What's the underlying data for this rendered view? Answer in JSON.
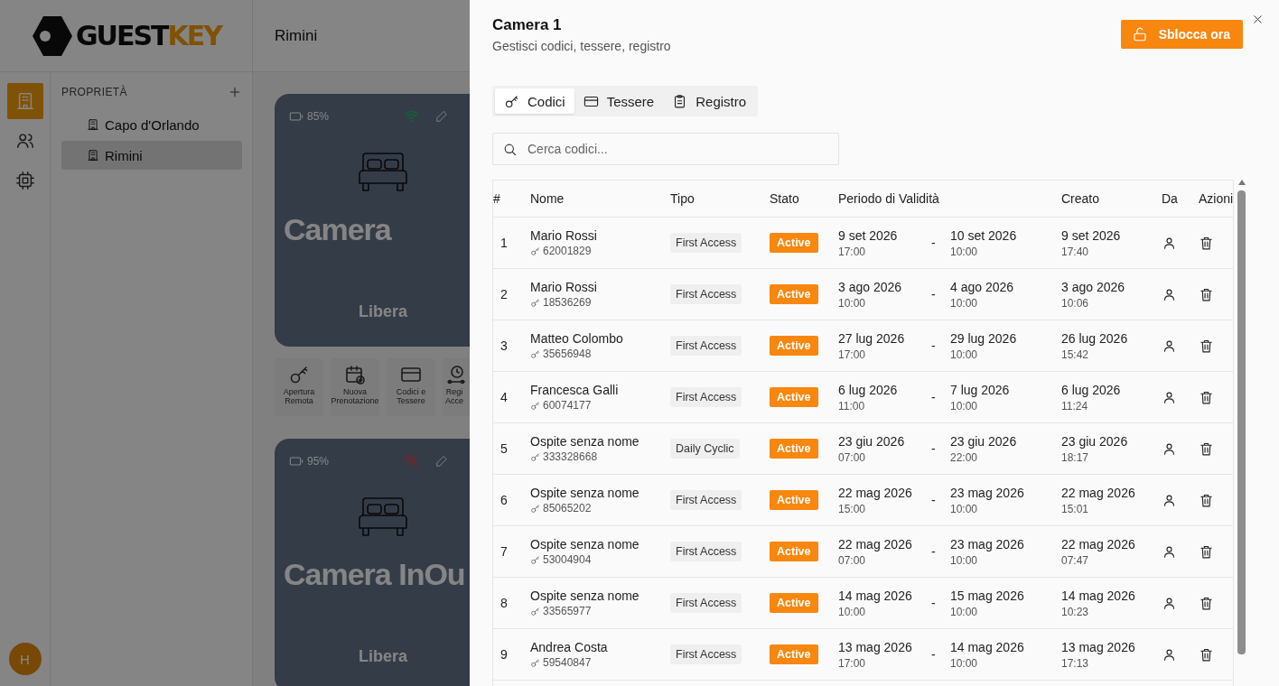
{
  "logo": {
    "dark": "GUEST",
    "accent": "KEY"
  },
  "rail": {
    "items": [
      {
        "selected": true
      },
      {
        "selected": false
      },
      {
        "selected": false
      }
    ],
    "avatar": "H"
  },
  "sidebar": {
    "heading": "PROPRIETÀ",
    "items": [
      {
        "label": "Capo d'Orlando",
        "selected": false
      },
      {
        "label": "Rimini",
        "selected": true
      }
    ]
  },
  "main": {
    "title": "Rimini",
    "rooms": [
      {
        "battery": "85%",
        "online": true,
        "name": "Camera",
        "status": "Libera",
        "actions": [
          "Apertura Remota",
          "Nuova Prenotazione",
          "Codici e Tessere",
          "Regi Acce"
        ]
      },
      {
        "battery": "95%",
        "online": false,
        "name": "Camera InOu",
        "status": "Libera"
      }
    ]
  },
  "drawer": {
    "title": "Camera 1",
    "subtitle": "Gestisci codici, tessere, registro",
    "unlock_button": "Sblocca ora",
    "tabs": [
      {
        "label": "Codici",
        "selected": true
      },
      {
        "label": "Tessere",
        "selected": false
      },
      {
        "label": "Registro",
        "selected": false
      }
    ],
    "search": {
      "placeholder": "Cerca codici..."
    },
    "table": {
      "columns": [
        "#",
        "Nome",
        "Tipo",
        "Stato",
        "Periodo di Validità",
        "Creato",
        "Da",
        "Azioni"
      ],
      "rows": [
        {
          "number": "1",
          "name": "Mario Rossi",
          "code": "62001829",
          "type": "First Access",
          "status": "Active",
          "start_date": "9 set 2026",
          "start_time": "17:00",
          "separator": "-",
          "end_date": "10 set 2026",
          "end_time": "10:00",
          "created_date": "9 set 2026",
          "created_time": "17:40"
        },
        {
          "number": "2",
          "name": "Mario Rossi",
          "code": "18536269",
          "type": "First Access",
          "status": "Active",
          "start_date": "3 ago 2026",
          "start_time": "10:00",
          "separator": "-",
          "end_date": "4 ago 2026",
          "end_time": "10:00",
          "created_date": "3 ago 2026",
          "created_time": "10:06"
        },
        {
          "number": "3",
          "name": "Matteo Colombo",
          "code": "35656948",
          "type": "First Access",
          "status": "Active",
          "start_date": "27 lug 2026",
          "start_time": "17:00",
          "separator": "-",
          "end_date": "29 lug 2026",
          "end_time": "10:00",
          "created_date": "26 lug 2026",
          "created_time": "15:42"
        },
        {
          "number": "4",
          "name": "Francesca Galli",
          "code": "60074177",
          "type": "First Access",
          "status": "Active",
          "start_date": "6 lug 2026",
          "start_time": "11:00",
          "separator": "-",
          "end_date": "7 lug 2026",
          "end_time": "10:00",
          "created_date": "6 lug 2026",
          "created_time": "11:24"
        },
        {
          "number": "5",
          "name": "Ospite senza nome",
          "code": "333328668",
          "type": "Daily Cyclic",
          "status": "Active",
          "start_date": "23 giu 2026",
          "start_time": "07:00",
          "separator": "-",
          "end_date": "23 giu 2026",
          "end_time": "22:00",
          "created_date": "23 giu 2026",
          "created_time": "18:17"
        },
        {
          "number": "6",
          "name": "Ospite senza nome",
          "code": "85065202",
          "type": "First Access",
          "status": "Active",
          "start_date": "22 mag 2026",
          "start_time": "15:00",
          "separator": "-",
          "end_date": "23 mag 2026",
          "end_time": "10:00",
          "created_date": "22 mag 2026",
          "created_time": "15:01"
        },
        {
          "number": "7",
          "name": "Ospite senza nome",
          "code": "53004904",
          "type": "First Access",
          "status": "Active",
          "start_date": "22 mag 2026",
          "start_time": "07:00",
          "separator": "-",
          "end_date": "23 mag 2026",
          "end_time": "10:00",
          "created_date": "22 mag 2026",
          "created_time": "07:47"
        },
        {
          "number": "8",
          "name": "Ospite senza nome",
          "code": "33565977",
          "type": "First Access",
          "status": "Active",
          "start_date": "14 mag 2026",
          "start_time": "10:00",
          "separator": "-",
          "end_date": "15 mag 2026",
          "end_time": "10:00",
          "created_date": "14 mag 2026",
          "created_time": "10:23"
        },
        {
          "number": "9",
          "name": "Andrea Costa",
          "code": "59540847",
          "type": "First Access",
          "status": "Active",
          "start_date": "13 mag 2026",
          "start_time": "17:00",
          "separator": "-",
          "end_date": "14 mag 2026",
          "end_time": "10:00",
          "created_date": "13 mag 2026",
          "created_time": "17:13"
        }
      ]
    }
  }
}
